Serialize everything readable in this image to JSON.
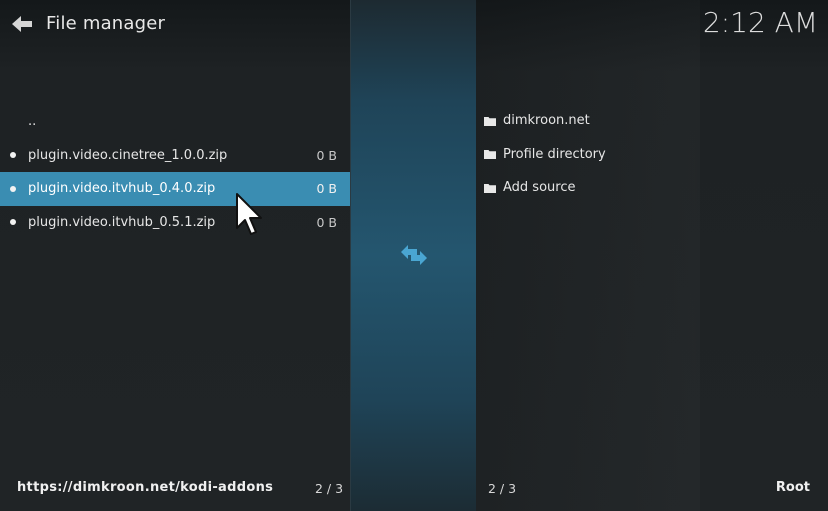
{
  "header": {
    "title": "File manager",
    "clock": "2:12 AM",
    "back_icon": "back-arrow-icon"
  },
  "left_panel": {
    "items": [
      {
        "name": "..",
        "size": "",
        "type": "parent"
      },
      {
        "name": "plugin.video.cinetree_1.0.0.zip",
        "size": "0 B",
        "type": "file"
      },
      {
        "name": "plugin.video.itvhub_0.4.0.zip",
        "size": "0 B",
        "type": "file",
        "selected": true
      },
      {
        "name": "plugin.video.itvhub_0.5.1.zip",
        "size": "0 B",
        "type": "file"
      }
    ],
    "footer_path": "https://dimkroon.net/kodi-addons",
    "footer_count": "2 / 3"
  },
  "right_panel": {
    "items": [
      {
        "name": "dimkroon.net",
        "type": "folder"
      },
      {
        "name": "Profile directory",
        "type": "folder"
      },
      {
        "name": "Add source",
        "type": "folder"
      }
    ],
    "footer_count": "2 / 3",
    "footer_path": "Root"
  },
  "center": {
    "swap_icon": "swap-arrows-icon"
  },
  "colors": {
    "accent": "#3a8db2",
    "swap_icon": "#3fa0d0",
    "background": "#1f2224"
  }
}
